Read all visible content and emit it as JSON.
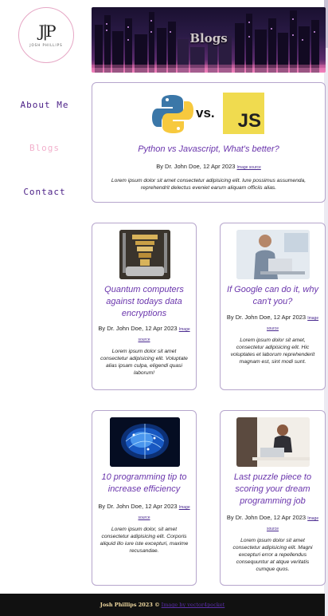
{
  "logo": {
    "mark": "J|P",
    "subtitle": "JOSH PHILLIPS"
  },
  "nav": {
    "about": "About Me",
    "blogs": "Blogs",
    "contact": "Contact"
  },
  "hero": {
    "title": "Blogs"
  },
  "featured": {
    "vs_text": "vs.",
    "js_badge": "JS",
    "title": "Python vs Javascript, What's better?",
    "byline": "By Dr. John Doe, 12 Apr 2023",
    "image_source": "Image source",
    "body": "Lorem ipsum dolor sit amet consectetur adipisicing elit. Iure possimus assumenda, reprehendrit delectus eveniet earum aliquam officiis alias."
  },
  "cards": [
    {
      "title": "Quantum computers against todays data encryptions",
      "byline": "By Dr. John Doe, 12 Apr 2023",
      "image_source": "Image source",
      "body": "Lorem ipsum dolor sit amet consectetur adipisicing elit. Voluptate alias ipsam culpa, eligendi quasi laborum!"
    },
    {
      "title": "If Google can do it, why can't you?",
      "byline": "By Dr. John Doe, 12 Apr 2023",
      "image_source": "Image source",
      "body": "Lorem ipsum dolor sit amet, consectetur adipisicing elit. Hic voluptates et laborum reprehenderit magnam est, sint modi sunt."
    },
    {
      "title": "10 programming tip to increase efficiency",
      "byline": "By Dr. John Doe, 12 Apr 2023",
      "image_source": "Image source",
      "body": "Lorem ipsum dolor, sit amet consectetur adipisicing elit. Corporis aliquid illo iure iste excepturi, maxime recusandae."
    },
    {
      "title": "Last puzzle piece to scoring your dream programming job",
      "byline": "By Dr. John Doe, 12 Apr 2023",
      "image_source": "Image source",
      "body": "Lorem ipsum dolor sit amet consectetur adipisicing elit. Magni excepturi error a repellendus consequuntur at atque veritatis cumque quos."
    }
  ],
  "footer": {
    "text": "Josh Phillips 2023 ©",
    "link": "Image by vector4pocket"
  },
  "colors": {
    "accent": "#6a35ac",
    "nav": "#4a1e86",
    "nav_active": "#f2b0cc",
    "card_border": "#b6a5cc",
    "footer_bg": "#111111"
  }
}
